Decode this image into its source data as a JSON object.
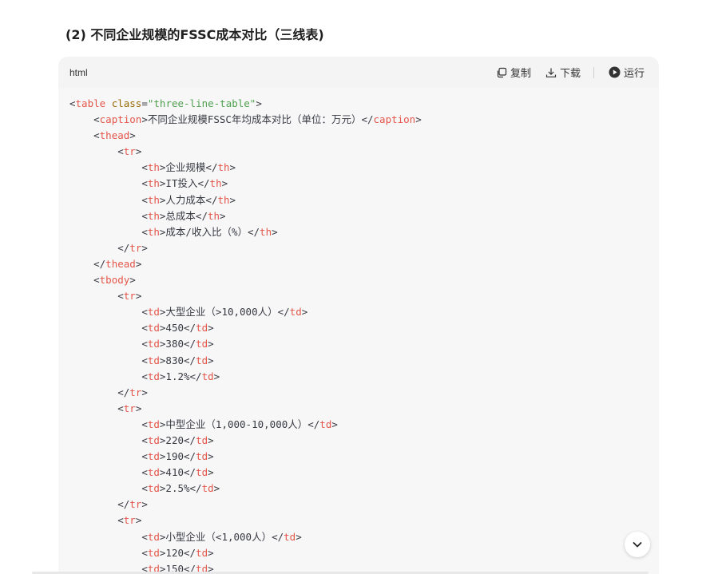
{
  "heading": "(2) 不同企业规模的FSSC成本对比（三线表)",
  "code_block": {
    "language": "html",
    "copy_label": "复制",
    "download_label": "下载",
    "run_label": "运行"
  },
  "code_lines": [
    {
      "indent": "",
      "parts": [
        [
          "p",
          "<"
        ],
        [
          "t",
          "table"
        ],
        [
          "p",
          " "
        ],
        [
          "a",
          "class"
        ],
        [
          "p",
          "="
        ],
        [
          "s",
          "\"three-line-table\""
        ],
        [
          "p",
          ">"
        ]
      ]
    },
    {
      "indent": "    ",
      "parts": [
        [
          "p",
          "<"
        ],
        [
          "t",
          "caption"
        ],
        [
          "p",
          ">不同企业规模FSSC年均成本对比（单位：万元）</"
        ],
        [
          "t",
          "caption"
        ],
        [
          "p",
          ">"
        ]
      ]
    },
    {
      "indent": "    ",
      "parts": [
        [
          "p",
          "<"
        ],
        [
          "t",
          "thead"
        ],
        [
          "p",
          ">"
        ]
      ]
    },
    {
      "indent": "        ",
      "parts": [
        [
          "p",
          "<"
        ],
        [
          "t",
          "tr"
        ],
        [
          "p",
          ">"
        ]
      ]
    },
    {
      "indent": "            ",
      "parts": [
        [
          "p",
          "<"
        ],
        [
          "t",
          "th"
        ],
        [
          "p",
          ">企业规模</"
        ],
        [
          "t",
          "th"
        ],
        [
          "p",
          ">"
        ]
      ]
    },
    {
      "indent": "            ",
      "parts": [
        [
          "p",
          "<"
        ],
        [
          "t",
          "th"
        ],
        [
          "p",
          ">IT投入</"
        ],
        [
          "t",
          "th"
        ],
        [
          "p",
          ">"
        ]
      ]
    },
    {
      "indent": "            ",
      "parts": [
        [
          "p",
          "<"
        ],
        [
          "t",
          "th"
        ],
        [
          "p",
          ">人力成本</"
        ],
        [
          "t",
          "th"
        ],
        [
          "p",
          ">"
        ]
      ]
    },
    {
      "indent": "            ",
      "parts": [
        [
          "p",
          "<"
        ],
        [
          "t",
          "th"
        ],
        [
          "p",
          ">总成本</"
        ],
        [
          "t",
          "th"
        ],
        [
          "p",
          ">"
        ]
      ]
    },
    {
      "indent": "            ",
      "parts": [
        [
          "p",
          "<"
        ],
        [
          "t",
          "th"
        ],
        [
          "p",
          ">成本/收入比（%）</"
        ],
        [
          "t",
          "th"
        ],
        [
          "p",
          ">"
        ]
      ]
    },
    {
      "indent": "        ",
      "parts": [
        [
          "p",
          "</"
        ],
        [
          "t",
          "tr"
        ],
        [
          "p",
          ">"
        ]
      ]
    },
    {
      "indent": "    ",
      "parts": [
        [
          "p",
          "</"
        ],
        [
          "t",
          "thead"
        ],
        [
          "p",
          ">"
        ]
      ]
    },
    {
      "indent": "    ",
      "parts": [
        [
          "p",
          "<"
        ],
        [
          "t",
          "tbody"
        ],
        [
          "p",
          ">"
        ]
      ]
    },
    {
      "indent": "        ",
      "parts": [
        [
          "p",
          "<"
        ],
        [
          "t",
          "tr"
        ],
        [
          "p",
          ">"
        ]
      ]
    },
    {
      "indent": "            ",
      "parts": [
        [
          "p",
          "<"
        ],
        [
          "t",
          "td"
        ],
        [
          "p",
          ">大型企业（>10,000人）</"
        ],
        [
          "t",
          "td"
        ],
        [
          "p",
          ">"
        ]
      ]
    },
    {
      "indent": "            ",
      "parts": [
        [
          "p",
          "<"
        ],
        [
          "t",
          "td"
        ],
        [
          "p",
          ">450</"
        ],
        [
          "t",
          "td"
        ],
        [
          "p",
          ">"
        ]
      ]
    },
    {
      "indent": "            ",
      "parts": [
        [
          "p",
          "<"
        ],
        [
          "t",
          "td"
        ],
        [
          "p",
          ">380</"
        ],
        [
          "t",
          "td"
        ],
        [
          "p",
          ">"
        ]
      ]
    },
    {
      "indent": "            ",
      "parts": [
        [
          "p",
          "<"
        ],
        [
          "t",
          "td"
        ],
        [
          "p",
          ">830</"
        ],
        [
          "t",
          "td"
        ],
        [
          "p",
          ">"
        ]
      ]
    },
    {
      "indent": "            ",
      "parts": [
        [
          "p",
          "<"
        ],
        [
          "t",
          "td"
        ],
        [
          "p",
          ">1.2%</"
        ],
        [
          "t",
          "td"
        ],
        [
          "p",
          ">"
        ]
      ]
    },
    {
      "indent": "        ",
      "parts": [
        [
          "p",
          "</"
        ],
        [
          "t",
          "tr"
        ],
        [
          "p",
          ">"
        ]
      ]
    },
    {
      "indent": "        ",
      "parts": [
        [
          "p",
          "<"
        ],
        [
          "t",
          "tr"
        ],
        [
          "p",
          ">"
        ]
      ]
    },
    {
      "indent": "            ",
      "parts": [
        [
          "p",
          "<"
        ],
        [
          "t",
          "td"
        ],
        [
          "p",
          ">中型企业（1,000-10,000人）</"
        ],
        [
          "t",
          "td"
        ],
        [
          "p",
          ">"
        ]
      ]
    },
    {
      "indent": "            ",
      "parts": [
        [
          "p",
          "<"
        ],
        [
          "t",
          "td"
        ],
        [
          "p",
          ">220</"
        ],
        [
          "t",
          "td"
        ],
        [
          "p",
          ">"
        ]
      ]
    },
    {
      "indent": "            ",
      "parts": [
        [
          "p",
          "<"
        ],
        [
          "t",
          "td"
        ],
        [
          "p",
          ">190</"
        ],
        [
          "t",
          "td"
        ],
        [
          "p",
          ">"
        ]
      ]
    },
    {
      "indent": "            ",
      "parts": [
        [
          "p",
          "<"
        ],
        [
          "t",
          "td"
        ],
        [
          "p",
          ">410</"
        ],
        [
          "t",
          "td"
        ],
        [
          "p",
          ">"
        ]
      ]
    },
    {
      "indent": "            ",
      "parts": [
        [
          "p",
          "<"
        ],
        [
          "t",
          "td"
        ],
        [
          "p",
          ">2.5%</"
        ],
        [
          "t",
          "td"
        ],
        [
          "p",
          ">"
        ]
      ]
    },
    {
      "indent": "        ",
      "parts": [
        [
          "p",
          "</"
        ],
        [
          "t",
          "tr"
        ],
        [
          "p",
          ">"
        ]
      ]
    },
    {
      "indent": "        ",
      "parts": [
        [
          "p",
          "<"
        ],
        [
          "t",
          "tr"
        ],
        [
          "p",
          ">"
        ]
      ]
    },
    {
      "indent": "            ",
      "parts": [
        [
          "p",
          "<"
        ],
        [
          "t",
          "td"
        ],
        [
          "p",
          ">小型企业（<1,000人）</"
        ],
        [
          "t",
          "td"
        ],
        [
          "p",
          ">"
        ]
      ]
    },
    {
      "indent": "            ",
      "parts": [
        [
          "p",
          "<"
        ],
        [
          "t",
          "td"
        ],
        [
          "p",
          ">120</"
        ],
        [
          "t",
          "td"
        ],
        [
          "p",
          ">"
        ]
      ]
    },
    {
      "indent": "            ",
      "parts": [
        [
          "p",
          "<"
        ],
        [
          "t",
          "td"
        ],
        [
          "p",
          ">150</"
        ],
        [
          "t",
          "td"
        ],
        [
          "p",
          ">"
        ]
      ]
    }
  ],
  "colors": {
    "tag": "#e45649",
    "attribute": "#986801",
    "string": "#50a14f",
    "text": "#383a42",
    "code_background": "#f7f7f8"
  },
  "icons": {
    "copy": "copy-icon",
    "download": "download-icon",
    "run": "play-circle-icon",
    "expand": "chevron-down-icon"
  }
}
